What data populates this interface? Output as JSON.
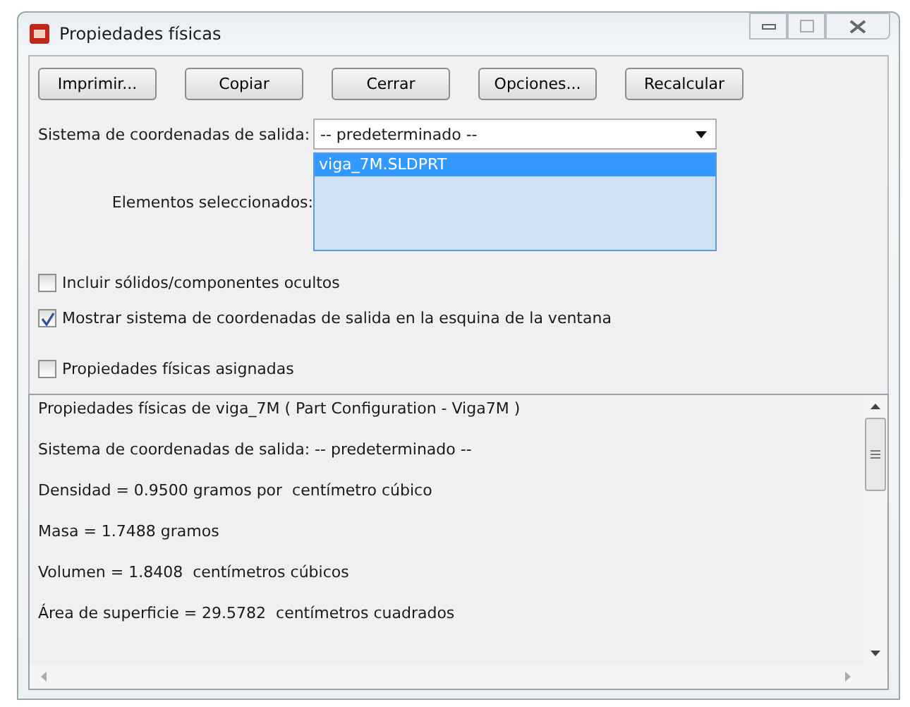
{
  "window": {
    "title": "Propiedades físicas"
  },
  "buttons": [
    "Imprimir...",
    "Copiar",
    "Cerrar",
    "Opciones...",
    "Recalcular"
  ],
  "output_coordinate_system": {
    "label": "Sistema de coordenadas de salida:",
    "value": "-- predeterminado --"
  },
  "selected_items": {
    "label": "Elementos seleccionados:",
    "items": [
      {
        "text": "viga_7M.SLDPRT",
        "selected": true
      }
    ]
  },
  "checkboxes": [
    {
      "label": "Incluir sólidos/componentes ocultos",
      "checked": false
    },
    {
      "label": "Mostrar sistema de coordenadas de salida en la esquina de la ventana",
      "checked": true
    },
    {
      "label": "Propiedades físicas asignadas",
      "checked": false
    }
  ],
  "results": [
    "Propiedades físicas de viga_7M ( Part Configuration - Viga7M )",
    "Sistema de coordenadas de salida: -- predeterminado --",
    "Densidad = 0.9500 gramos por  centímetro cúbico",
    "Masa = 1.7488 gramos",
    "Volumen = 1.8408  centímetros cúbicos",
    "Área de superficie = 29.5782  centímetros cuadrados"
  ]
}
